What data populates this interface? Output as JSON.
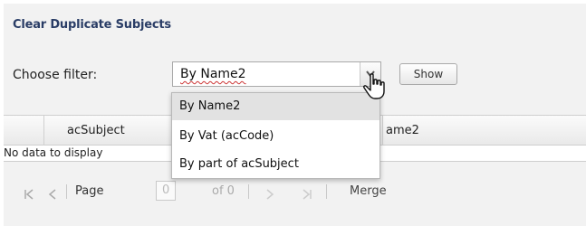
{
  "panel": {
    "title": "Clear Duplicate Subjects"
  },
  "filter": {
    "label": "Choose filter:",
    "selected": "By Name2",
    "options": [
      "By Name2",
      "By Vat (acCode)",
      "By part of acSubject"
    ],
    "show_label": "Show"
  },
  "grid": {
    "columns": [
      "acSubject",
      "ame2"
    ],
    "empty_text": "No data to display"
  },
  "pager": {
    "page_label": "Page",
    "page_value": "0",
    "of_label": "of 0",
    "merge_label": "Merge"
  },
  "icons": {
    "dropdown": "chevron-down-icon",
    "cursor": "hand-pointer-icon",
    "first": "first-page-icon",
    "prev": "prev-page-icon",
    "next": "next-page-icon",
    "last": "last-page-icon"
  },
  "colors": {
    "title": "#2a3d66",
    "panel_bg": "#f2f2f2",
    "selected_item_bg": "#e2e2e2"
  }
}
